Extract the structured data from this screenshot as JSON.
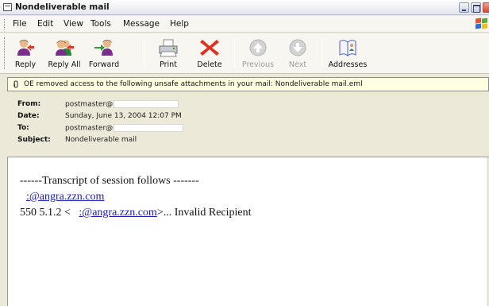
{
  "window": {
    "title": "Nondeliverable mail"
  },
  "menu": {
    "items": [
      "File",
      "Edit",
      "View",
      "Tools",
      "Message",
      "Help"
    ]
  },
  "toolbar": {
    "buttons": [
      {
        "label": "Reply",
        "icon": "reply-icon",
        "enabled": true
      },
      {
        "label": "Reply All",
        "icon": "reply-all-icon",
        "enabled": true
      },
      {
        "label": "Forward",
        "icon": "forward-icon",
        "enabled": true
      },
      {
        "label": "Print",
        "icon": "printer-icon",
        "enabled": true
      },
      {
        "label": "Delete",
        "icon": "delete-x-icon",
        "enabled": true
      },
      {
        "label": "Previous",
        "icon": "previous-arrow-icon",
        "enabled": false
      },
      {
        "label": "Next",
        "icon": "next-arrow-icon",
        "enabled": false
      },
      {
        "label": "Addresses",
        "icon": "address-book-icon",
        "enabled": true
      }
    ]
  },
  "infobar": {
    "text": "OE removed access to the following unsafe attachments in your mail: Nondeliverable mail.eml",
    "icon": "paperclip-icon"
  },
  "headers": {
    "from_label": "From:",
    "from_value": "postmaster@",
    "date_label": "Date:",
    "date_value": "Sunday, June 13, 2004 12:07 PM",
    "to_label": "To:",
    "to_value": "postmaster@",
    "subject_label": "Subject:",
    "subject_value": "Nondeliverable mail"
  },
  "message": {
    "line1": "------Transcript of session follows -------",
    "line2_link": ":@angra.zzn.com",
    "line3_prefix": "550 5.1.2 <",
    "line3_link": ":@angra.zzn.com",
    "line3_suffix": ">... Invalid Recipient"
  },
  "colors": {
    "infobar_bg": "#ffffe1",
    "link": "#1a1ab4",
    "delete_red": "#e0301e",
    "chrome_bg": "#ece9d8"
  }
}
